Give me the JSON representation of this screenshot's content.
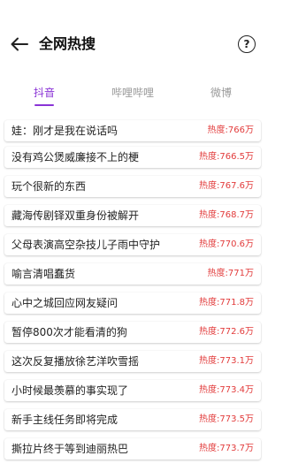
{
  "header": {
    "title": "全网热搜",
    "help_label": "?"
  },
  "tabs": [
    {
      "label": "抖音",
      "active": true
    },
    {
      "label": "哔哩哔哩",
      "active": false
    },
    {
      "label": "微博",
      "active": false
    }
  ],
  "colors": {
    "accent": "#8a33d6",
    "heat": "#e23b3b",
    "inactive_tab": "#9a9a9a"
  },
  "list": [
    {
      "topic": "娃：刚才是我在说话吗",
      "heat": "热度:766万"
    },
    {
      "topic": "没有鸡公煲威廉接不上的梗",
      "heat": "热度:766.5万"
    },
    {
      "topic": "玩个很新的东西",
      "heat": "热度:767.6万"
    },
    {
      "topic": "藏海传剧铎双重身份被解开",
      "heat": "热度:768.7万"
    },
    {
      "topic": "父母表演高空杂技儿子雨中守护",
      "heat": "热度:770.6万"
    },
    {
      "topic": "喻言清唱蠢货",
      "heat": "热度:771万"
    },
    {
      "topic": "心中之城回应网友疑问",
      "heat": "热度:771.8万"
    },
    {
      "topic": "暂停800次才能看清的狗",
      "heat": "热度:772.6万"
    },
    {
      "topic": "这次反复播放徐艺洋吹雪摇",
      "heat": "热度:773.1万"
    },
    {
      "topic": "小时候最羡慕的事实现了",
      "heat": "热度:773.4万"
    },
    {
      "topic": "新手主线任务即将完成",
      "heat": "热度:773.5万"
    },
    {
      "topic": "撕拉片终于等到迪丽热巴",
      "heat": "热度:773.7万"
    }
  ]
}
